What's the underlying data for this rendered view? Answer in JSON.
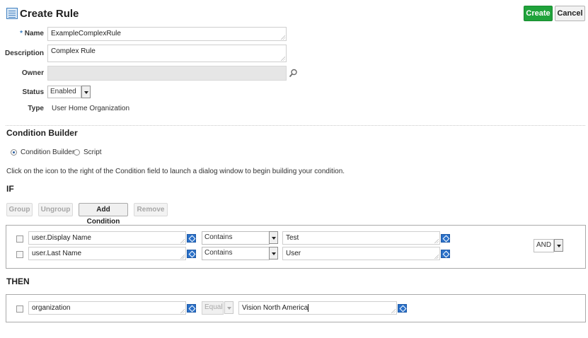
{
  "header": {
    "title": "Create Rule",
    "create_label": "Create",
    "cancel_label": "Cancel"
  },
  "form": {
    "name_label": "Name",
    "name_value": "ExampleComplexRule",
    "description_label": "Description",
    "description_value": "Complex Rule",
    "owner_label": "Owner",
    "owner_value": "",
    "status_label": "Status",
    "status_value": "Enabled",
    "type_label": "Type",
    "type_value": "User Home Organization",
    "required_marker": "*"
  },
  "condition_builder": {
    "heading": "Condition Builder",
    "mode_builder": "Condition Builder",
    "mode_script": "Script",
    "instruction": "Click on the icon to the right of the Condition field to launch a dialog window to begin building your condition."
  },
  "if_section": {
    "heading": "IF",
    "toolbar": {
      "group": "Group",
      "ungroup": "Ungroup",
      "add_condition": "Add Condition",
      "remove": "Remove"
    },
    "conditions": [
      {
        "attribute": "user.Display Name",
        "operator": "Contains",
        "value": "Test"
      },
      {
        "attribute": "user.Last Name",
        "operator": "Contains",
        "value": "User"
      }
    ],
    "conjunction": "AND"
  },
  "then_section": {
    "heading": "THEN",
    "attribute": "organization",
    "operator": "Equal",
    "value": "Vision North America"
  }
}
